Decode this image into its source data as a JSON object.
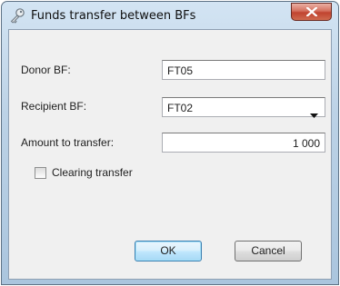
{
  "window": {
    "title": "Funds transfer between BFs",
    "icon": "key-icon",
    "close_glyph": "X"
  },
  "form": {
    "donor": {
      "label": "Donor BF:",
      "value": "FT05"
    },
    "recipient": {
      "label": "Recipient BF:",
      "value": "FT02"
    },
    "amount": {
      "label": "Amount to transfer:",
      "value": "1 000"
    },
    "clearing": {
      "label": "Clearing transfer",
      "checked": false
    }
  },
  "buttons": {
    "ok": "OK",
    "cancel": "Cancel"
  },
  "colors": {
    "title_bar": "#bcd2e6",
    "close_button": "#c0432f",
    "default_button_border": "#3c7fb1"
  }
}
